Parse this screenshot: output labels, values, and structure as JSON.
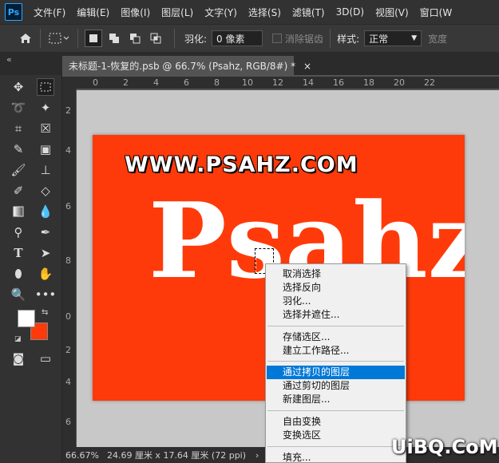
{
  "app": {
    "logo": "Ps"
  },
  "menubar": {
    "items": [
      "文件(F)",
      "编辑(E)",
      "图像(I)",
      "图层(L)",
      "文字(Y)",
      "选择(S)",
      "滤镜(T)",
      "3D(D)",
      "视图(V)",
      "窗口(W"
    ]
  },
  "options": {
    "home_icon": "home-icon",
    "marquee_icon": "rect-marquee-icon",
    "feather_label": "羽化:",
    "feather_value": "0 像素",
    "antialias_label": "消除锯齿",
    "style_label": "样式:",
    "style_value": "正常",
    "width_label": "宽度"
  },
  "tab": {
    "collapse": "«",
    "title": "未标题-1-恢复的.psb @ 66.7% (Psahz, RGB/8#) *",
    "close": "×"
  },
  "rulers": {
    "top": [
      "0",
      "2",
      "4",
      "6",
      "8",
      "10",
      "12",
      "14",
      "16",
      "18",
      "20",
      "22"
    ],
    "left": [
      "2",
      "4",
      "6",
      "8",
      "0",
      "2",
      "4",
      "6"
    ]
  },
  "artwork": {
    "url_text": "WWW.PSAHZ.COM",
    "brand_text": "Psahz"
  },
  "status": {
    "zoom": "66.67%",
    "info": "24.69 厘米 x 17.64 厘米 (72 ppi)",
    "arrow": "›"
  },
  "context_menu": {
    "items": [
      {
        "label": "取消选择"
      },
      {
        "label": "选择反向"
      },
      {
        "label": "羽化..."
      },
      {
        "label": "选择并遮住..."
      },
      {
        "label": "存储选区..."
      },
      {
        "label": "建立工作路径..."
      },
      {
        "label": "通过拷贝的图层"
      },
      {
        "label": "通过剪切的图层"
      },
      {
        "label": "新建图层..."
      },
      {
        "label": "自由变换"
      },
      {
        "label": "变换选区"
      },
      {
        "label": "填充..."
      }
    ],
    "highlighted": "通过拷贝的图层"
  },
  "colors": {
    "foreground": "#ffffff",
    "background": "#ff3a0a",
    "canvas_bg": "#ff3a0a",
    "highlight": "#0078d7"
  },
  "watermark": "UiBQ.CoM"
}
